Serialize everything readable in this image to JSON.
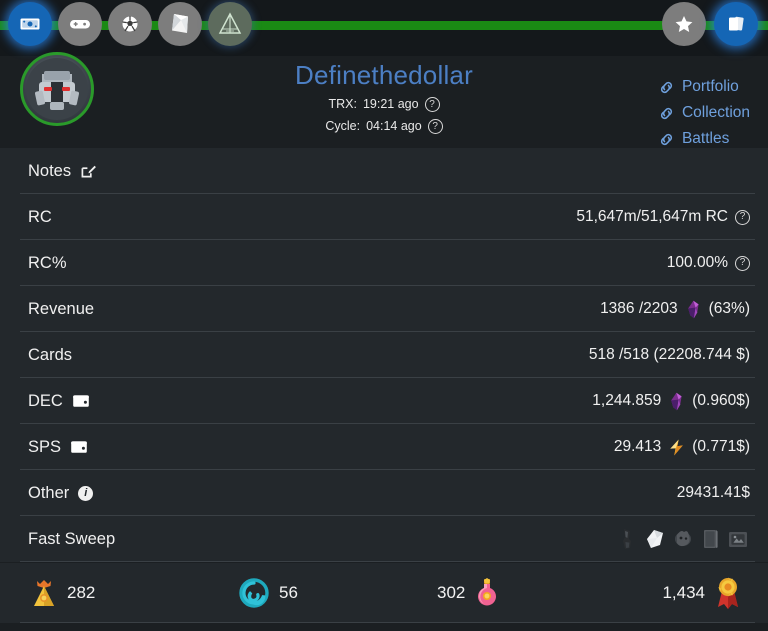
{
  "theme": {
    "bg": "#1b1f22",
    "row_bg": "#23282c",
    "accent_green": "#1a8a14",
    "title_blue": "#4c7fc4",
    "link_blue": "#6fa0dd",
    "divider": "#3a4045"
  },
  "topnav": {
    "left_items": [
      {
        "name": "money-icon",
        "label": "Money",
        "active": true
      },
      {
        "name": "gamepad-icon",
        "label": "Play",
        "active": false
      },
      {
        "name": "soccer-ball-icon",
        "label": "Tournaments",
        "active": false
      },
      {
        "name": "card-pack-icon",
        "label": "Packs",
        "active": false
      },
      {
        "name": "pyramid-logo-icon",
        "label": "Land",
        "active": false
      }
    ],
    "right_items": [
      {
        "name": "star-icon",
        "label": "Favorites",
        "active": false
      },
      {
        "name": "cards-icon",
        "label": "Cards",
        "active": true
      }
    ]
  },
  "header": {
    "avatar_alt": "robot-avatar",
    "title": "Definethedollar",
    "trx_label": "TRX:",
    "trx_value": "19:21 ago",
    "cycle_label": "Cycle:",
    "cycle_value": "04:14 ago",
    "links": [
      {
        "label": "Portfolio"
      },
      {
        "label": "Collection"
      },
      {
        "label": "Battles"
      }
    ]
  },
  "rows": [
    {
      "id": "notes",
      "label": "Notes",
      "label_icon": "edit-pencil-icon",
      "value": ""
    },
    {
      "id": "rc",
      "label": "RC",
      "value": "51,647m/51,647m RC",
      "help": true
    },
    {
      "id": "rcpct",
      "label": "RC%",
      "value": "100.00%",
      "help": true
    },
    {
      "id": "revenue",
      "label": "Revenue",
      "value": "1386 /2203",
      "gem": "dec-crystal",
      "suffix": "(63%)"
    },
    {
      "id": "cards",
      "label": "Cards",
      "value": "518 /518 (22208.744 $)"
    },
    {
      "id": "dec",
      "label": "DEC",
      "label_icon": "wallet-icon",
      "value": "1,244.859",
      "gem": "dec-crystal",
      "suffix": "(0.960$)"
    },
    {
      "id": "sps",
      "label": "SPS",
      "label_icon": "wallet-icon",
      "value": "29.413",
      "gem": "sps-bolt",
      "suffix": "(0.771$)"
    },
    {
      "id": "other",
      "label": "Other",
      "label_icon": "info-icon",
      "value": "29431.41$"
    },
    {
      "id": "fastsweep",
      "label": "Fast Sweep",
      "value": ""
    }
  ],
  "fast_sweep_icons": [
    "dark-totem-icon",
    "white-scroll-icon",
    "gray-creature-icon",
    "gray-card-icon",
    "gray-frame-icon"
  ],
  "stats": [
    {
      "id": "stat-glint",
      "icon": "gold-pouch-icon",
      "value": "282",
      "icon_side": "left"
    },
    {
      "id": "stat-energy",
      "icon": "teal-spiral-icon",
      "value": "56",
      "icon_side": "left"
    },
    {
      "id": "stat-potion",
      "icon": "pink-potion-icon",
      "value": "302",
      "icon_side": "right"
    },
    {
      "id": "stat-medal",
      "icon": "gold-medal-icon",
      "value": "1,434",
      "icon_side": "right"
    }
  ]
}
